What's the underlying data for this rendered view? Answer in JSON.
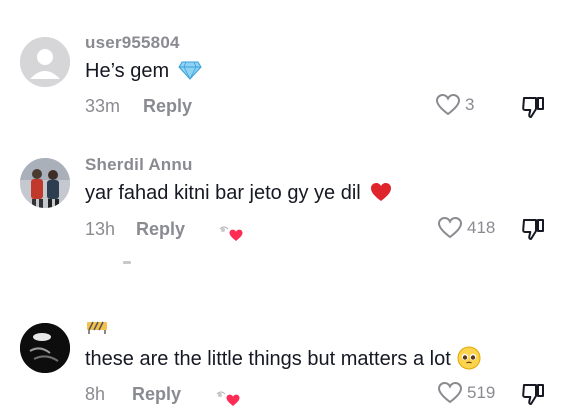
{
  "comments": [
    {
      "username": "user955804",
      "text": "He’s gem",
      "emoji_icon": "gem-icon",
      "time": "33m",
      "reply_label": "Reply",
      "likes": "3",
      "creator_liked": false
    },
    {
      "username": "Sherdil Annu",
      "text": "yar fahad kitni bar jeto gy ye dil",
      "emoji_icon": "red-heart-icon",
      "time": "13h",
      "reply_label": "Reply",
      "likes": "418",
      "creator_liked": true
    },
    {
      "username": "",
      "text": "these are the little things but matters a lot",
      "emoji_icon": "pleading-face-icon",
      "time": "8h",
      "reply_label": "Reply",
      "likes": "519",
      "creator_liked": true
    }
  ],
  "colors": {
    "text": "#161823",
    "secondary": "#8a8b91",
    "heart_red": "#fe2c55",
    "gem_blue": "#4fb3e8"
  }
}
